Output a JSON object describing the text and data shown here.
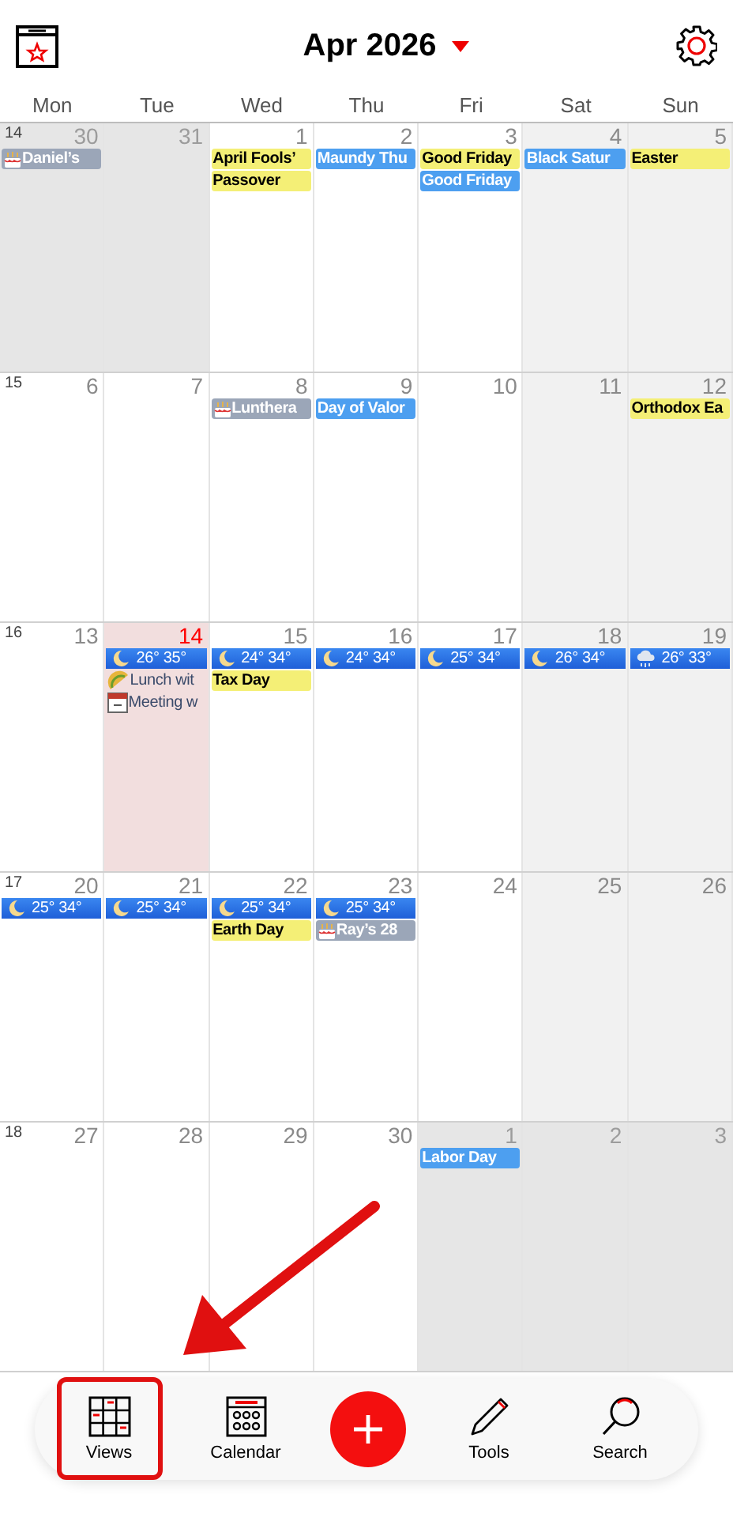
{
  "header": {
    "title": "Apr 2026"
  },
  "weekdays": [
    "Mon",
    "Tue",
    "Wed",
    "Thu",
    "Fri",
    "Sat",
    "Sun"
  ],
  "weeks": [
    {
      "number": "14",
      "days": [
        {
          "day": "30",
          "kind": "other_month",
          "events": [
            {
              "kind": "birthday",
              "text": "Daniel’s"
            }
          ]
        },
        {
          "day": "31",
          "kind": "other_month"
        },
        {
          "day": "1",
          "kind": "weekday",
          "events": [
            {
              "kind": "holiday",
              "text": "April Fools’"
            },
            {
              "kind": "holiday",
              "text": "Passover"
            }
          ]
        },
        {
          "day": "2",
          "kind": "weekday",
          "events": [
            {
              "kind": "observance",
              "text": "Maundy Thu"
            }
          ]
        },
        {
          "day": "3",
          "kind": "weekday",
          "events": [
            {
              "kind": "holiday",
              "text": "Good Friday"
            },
            {
              "kind": "observance",
              "text": "Good Friday"
            }
          ]
        },
        {
          "day": "4",
          "kind": "weekend",
          "events": [
            {
              "kind": "observance",
              "text": "Black Satur"
            }
          ]
        },
        {
          "day": "5",
          "kind": "weekend",
          "events": [
            {
              "kind": "holiday",
              "text": "Easter"
            }
          ]
        }
      ]
    },
    {
      "number": "15",
      "days": [
        {
          "day": "6",
          "kind": "weekday"
        },
        {
          "day": "7",
          "kind": "weekday"
        },
        {
          "day": "8",
          "kind": "weekday",
          "events": [
            {
              "kind": "birthday",
              "text": "Lunthera"
            }
          ]
        },
        {
          "day": "9",
          "kind": "weekday",
          "events": [
            {
              "kind": "observance",
              "text": "Day of Valor"
            }
          ]
        },
        {
          "day": "10",
          "kind": "weekday"
        },
        {
          "day": "11",
          "kind": "weekend"
        },
        {
          "day": "12",
          "kind": "weekend",
          "events": [
            {
              "kind": "holiday",
              "text": "Orthodox Ea"
            }
          ]
        }
      ]
    },
    {
      "number": "16",
      "days": [
        {
          "day": "13",
          "kind": "weekday"
        },
        {
          "day": "14",
          "kind": "today",
          "events": [
            {
              "kind": "weather_clear",
              "text": "26° 35°"
            },
            {
              "kind": "meal",
              "text": "Lunch wit"
            },
            {
              "kind": "meeting",
              "text": "Meeting w"
            }
          ]
        },
        {
          "day": "15",
          "kind": "weekday",
          "events": [
            {
              "kind": "weather_clear",
              "text": "24° 34°"
            },
            {
              "kind": "holiday",
              "text": "Tax Day"
            }
          ]
        },
        {
          "day": "16",
          "kind": "weekday",
          "events": [
            {
              "kind": "weather_clear",
              "text": "24° 34°"
            }
          ]
        },
        {
          "day": "17",
          "kind": "weekday",
          "events": [
            {
              "kind": "weather_clear",
              "text": "25° 34°"
            }
          ]
        },
        {
          "day": "18",
          "kind": "weekend",
          "events": [
            {
              "kind": "weather_clear",
              "text": "26° 34°"
            }
          ]
        },
        {
          "day": "19",
          "kind": "weekend",
          "events": [
            {
              "kind": "weather_rain",
              "text": "26° 33°"
            }
          ]
        }
      ]
    },
    {
      "number": "17",
      "days": [
        {
          "day": "20",
          "kind": "weekday",
          "events": [
            {
              "kind": "weather_clear",
              "text": "25° 34°"
            }
          ]
        },
        {
          "day": "21",
          "kind": "weekday",
          "events": [
            {
              "kind": "weather_clear",
              "text": "25° 34°"
            }
          ]
        },
        {
          "day": "22",
          "kind": "weekday",
          "events": [
            {
              "kind": "weather_clear",
              "text": "25° 34°"
            },
            {
              "kind": "holiday",
              "text": "Earth Day"
            }
          ]
        },
        {
          "day": "23",
          "kind": "weekday",
          "events": [
            {
              "kind": "weather_clear",
              "text": "25° 34°"
            },
            {
              "kind": "birthday",
              "text": "Ray’s 28"
            }
          ]
        },
        {
          "day": "24",
          "kind": "weekday"
        },
        {
          "day": "25",
          "kind": "weekend"
        },
        {
          "day": "26",
          "kind": "weekend"
        }
      ]
    },
    {
      "number": "18",
      "days": [
        {
          "day": "27",
          "kind": "weekday"
        },
        {
          "day": "28",
          "kind": "weekday"
        },
        {
          "day": "29",
          "kind": "weekday"
        },
        {
          "day": "30",
          "kind": "weekday"
        },
        {
          "day": "1",
          "kind": "other_month",
          "events": [
            {
              "kind": "observance",
              "text": "Labor Day"
            }
          ]
        },
        {
          "day": "2",
          "kind": "other_month"
        },
        {
          "day": "3",
          "kind": "other_month"
        }
      ]
    }
  ],
  "toolbar": [
    {
      "kind": "views",
      "label": "Views"
    },
    {
      "kind": "calendar",
      "label": "Calendar"
    },
    {
      "kind": "add"
    },
    {
      "kind": "tools",
      "label": "Tools"
    },
    {
      "kind": "search",
      "label": "Search"
    }
  ]
}
